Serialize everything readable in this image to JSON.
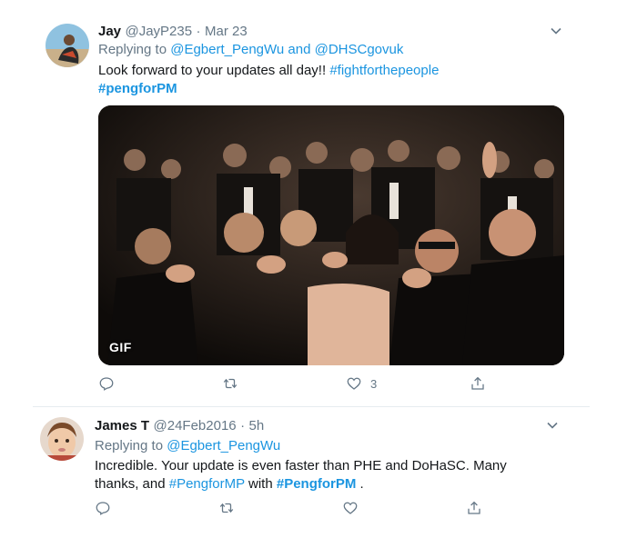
{
  "tweet1": {
    "name": "Jay",
    "handle": "@JayP235",
    "sep": "·",
    "date": "Mar 23",
    "replying_prefix": "Replying to",
    "replying_mentions": "@Egbert_PengWu and @DHSCgovuk",
    "text_plain": "Look forward to your updates all day!! ",
    "hashtag1": "#fightforthepeople",
    "hashtag2": "#pengforPM",
    "media_badge": "GIF",
    "like_count": "3",
    "icons": [
      "reply-icon",
      "retweet-icon",
      "like-icon",
      "share-icon",
      "chevron-down-icon"
    ]
  },
  "tweet2": {
    "name": "James T",
    "handle": "@24Feb2016",
    "sep": "·",
    "date": "5h",
    "replying_prefix": "Replying to",
    "replying_mentions": "@Egbert_PengWu",
    "line1": "Incredible. Your update is even faster than PHE and DoHaSC. Many",
    "line2_a": "thanks, and ",
    "hashtag1": "#PengforMP",
    "line2_b": " with ",
    "hashtag2": "#PengforPM",
    "line2_c": " .",
    "icons": [
      "reply-icon",
      "retweet-icon",
      "like-icon",
      "share-icon",
      "chevron-down-icon"
    ]
  },
  "colors": {
    "link": "#1b95e0",
    "muted": "#657786",
    "text": "#14171a",
    "divider": "#e6ecf0"
  }
}
